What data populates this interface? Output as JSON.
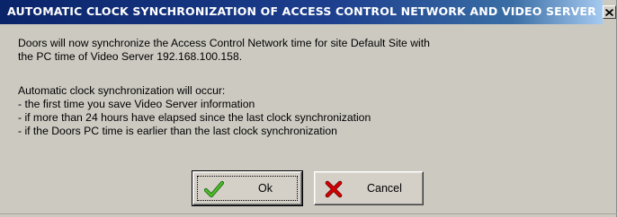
{
  "window": {
    "title": "AUTOMATIC CLOCK SYNCHRONIZATION OF ACCESS CONTROL NETWORK AND VIDEO SERVER",
    "close_icon": "close-icon"
  },
  "message": {
    "line1": "Doors will now synchronize the Access Control Network time for site Default Site with",
    "line2": "the PC time of Video Server 192.168.100.158.",
    "line3": "Automatic clock synchronization will occur:",
    "line4": "- the first time you save Video Server information",
    "line5": "- if more than 24 hours have elapsed since the last clock synchronization",
    "line6": "- if the Doors PC time is earlier than the last clock synchronization"
  },
  "buttons": {
    "ok_label": "Ok",
    "ok_icon": "checkmark-icon",
    "cancel_label": "Cancel",
    "cancel_icon": "x-mark-icon"
  },
  "colors": {
    "title_bar": "#0a246a",
    "dialog_face": "#ccc9c1",
    "checkmark": "#2e8b1e",
    "cancel_x": "#c40000"
  }
}
